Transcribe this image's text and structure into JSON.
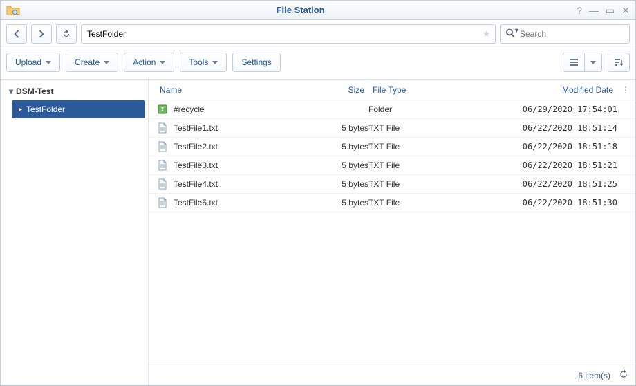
{
  "window": {
    "title": "File Station"
  },
  "nav": {
    "path": "TestFolder",
    "search_placeholder": "Search"
  },
  "toolbar": {
    "upload": "Upload",
    "create": "Create",
    "action": "Action",
    "tools": "Tools",
    "settings": "Settings"
  },
  "tree": {
    "root": "DSM-Test",
    "selected": "TestFolder"
  },
  "columns": {
    "name": "Name",
    "size": "Size",
    "type": "File Type",
    "modified": "Modified Date"
  },
  "rows": [
    {
      "name": "#recycle",
      "size": "",
      "type": "Folder",
      "modified": "06/29/2020 17:54:01",
      "icon": "recycle"
    },
    {
      "name": "TestFile1.txt",
      "size": "5 bytes",
      "type": "TXT File",
      "modified": "06/22/2020 18:51:14",
      "icon": "txt"
    },
    {
      "name": "TestFile2.txt",
      "size": "5 bytes",
      "type": "TXT File",
      "modified": "06/22/2020 18:51:18",
      "icon": "txt"
    },
    {
      "name": "TestFile3.txt",
      "size": "5 bytes",
      "type": "TXT File",
      "modified": "06/22/2020 18:51:21",
      "icon": "txt"
    },
    {
      "name": "TestFile4.txt",
      "size": "5 bytes",
      "type": "TXT File",
      "modified": "06/22/2020 18:51:25",
      "icon": "txt"
    },
    {
      "name": "TestFile5.txt",
      "size": "5 bytes",
      "type": "TXT File",
      "modified": "06/22/2020 18:51:30",
      "icon": "txt"
    }
  ],
  "status": {
    "count": "6 item(s)"
  }
}
